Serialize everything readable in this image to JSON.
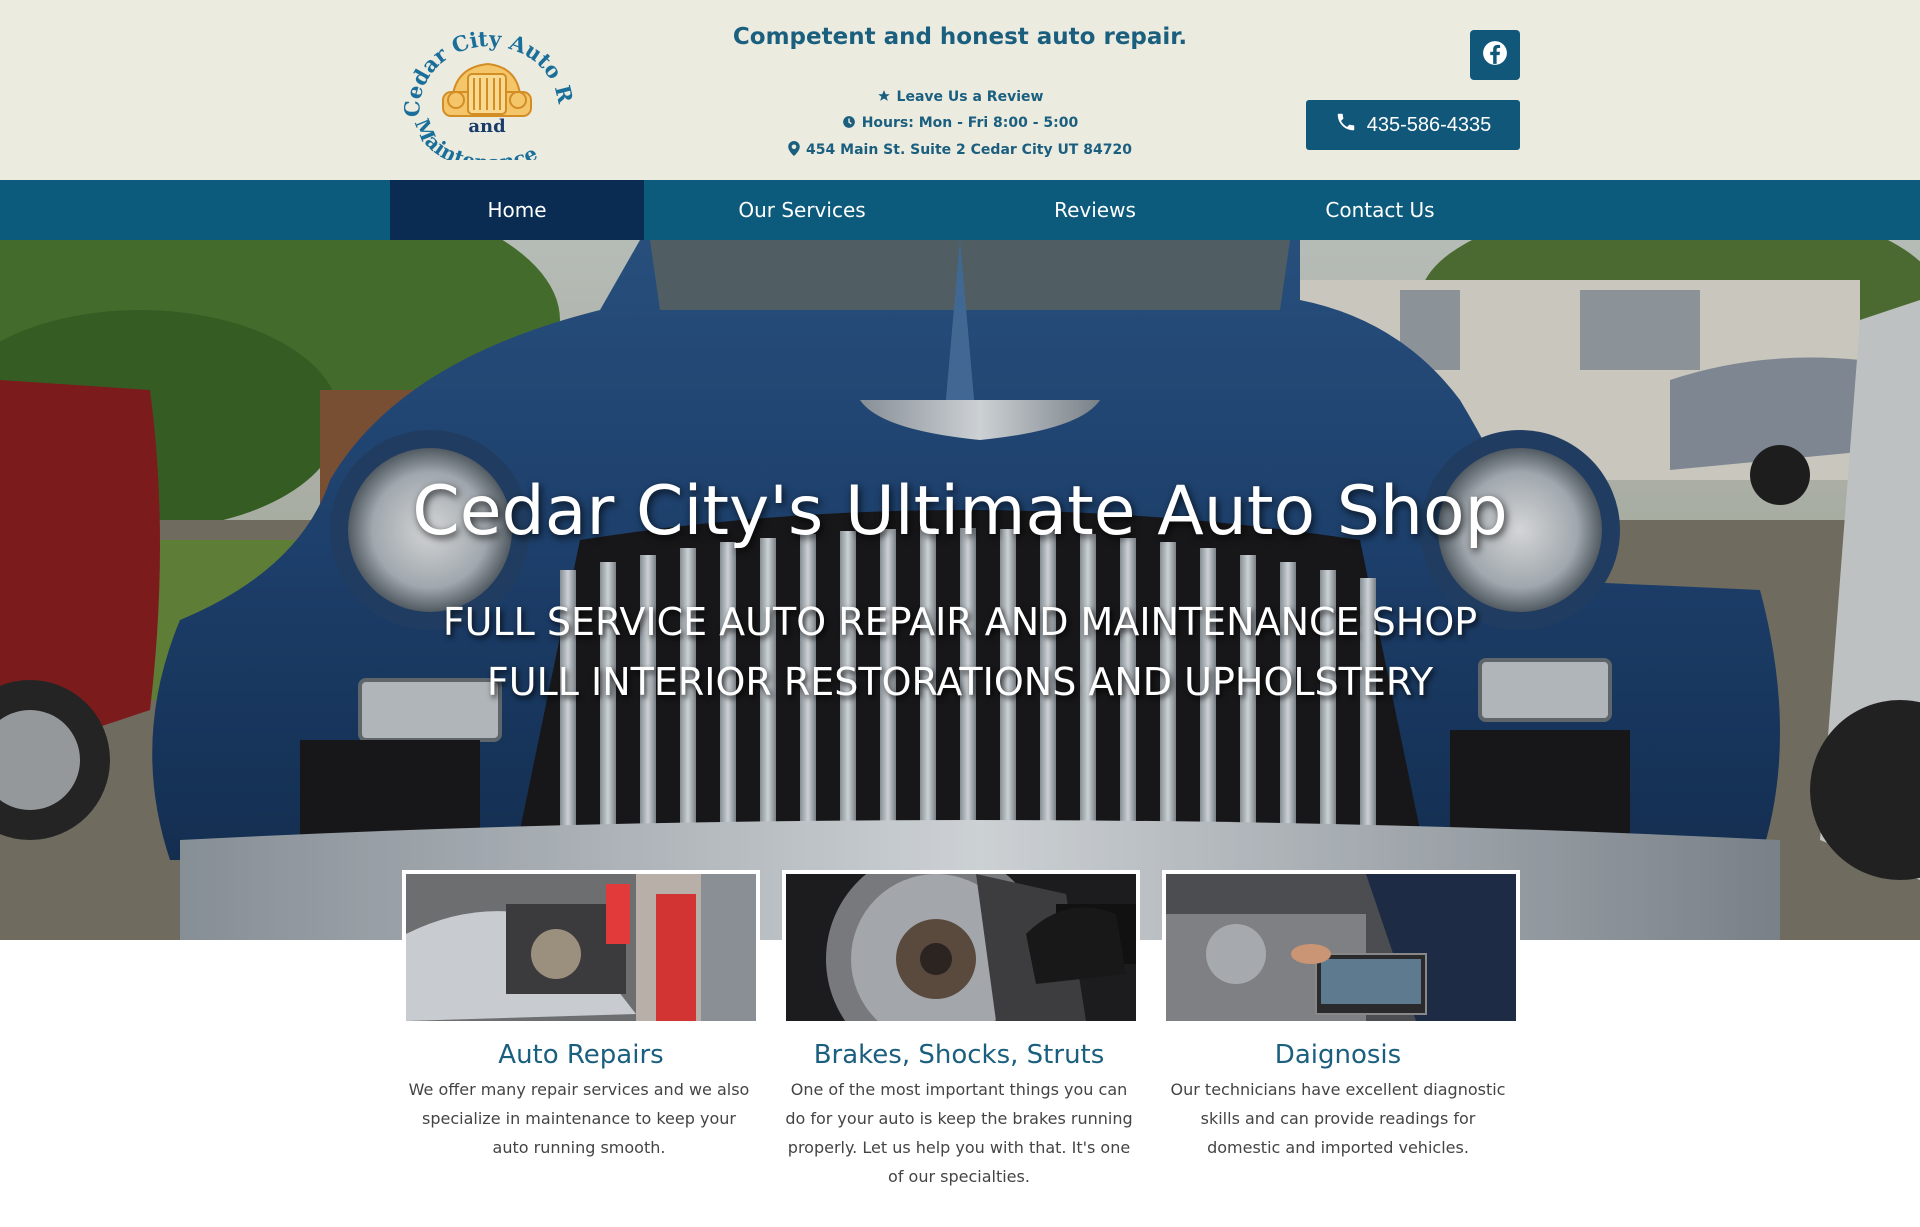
{
  "header": {
    "logo_text_top": "Cedar City Auto Repair",
    "logo_text_and": "and",
    "logo_text_bottom": "Maintenance",
    "tagline": "Competent and honest auto repair.",
    "review_link": "Leave Us a Review",
    "hours": "Hours: Mon - Fri 8:00 - 5:00",
    "address": "454 Main St. Suite 2 Cedar City UT 84720",
    "phone": "435-586-4335"
  },
  "nav": {
    "items": [
      {
        "label": "Home"
      },
      {
        "label": "Our Services"
      },
      {
        "label": "Reviews"
      },
      {
        "label": "Contact Us"
      }
    ]
  },
  "hero": {
    "title": "Cedar City's Ultimate Auto Shop",
    "sub1": "FULL SERVICE AUTO REPAIR AND MAINTENANCE SHOP",
    "sub2": "FULL INTERIOR RESTORATIONS AND UPHOLSTERY"
  },
  "services": [
    {
      "title": "Auto Repairs",
      "text": "We offer many repair services and we also specialize in maintenance to keep your auto running smooth."
    },
    {
      "title": "Brakes, Shocks, Struts",
      "text": "One of the most important things you can do for your auto is keep the brakes running properly. Let us help you with that. It's one of our specialties."
    },
    {
      "title": "Daignosis",
      "text": "Our technicians have excellent diagnostic skills and can provide readings for domestic and imported vehicles."
    }
  ],
  "colors": {
    "header_bg": "#ecebe0",
    "brand_blue": "#0c5a7c",
    "nav_active": "#0b2c52",
    "text_blue": "#1b5f7f"
  }
}
